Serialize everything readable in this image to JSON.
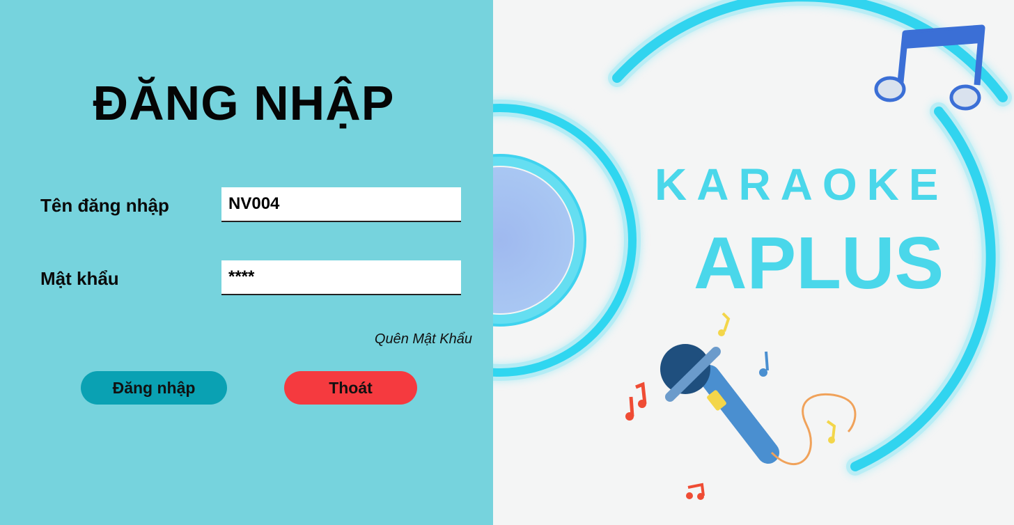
{
  "login": {
    "title": "ĐĂNG NHẬP",
    "username_label": "Tên đăng nhập",
    "username_value": "NV004",
    "password_label": "Mật khẩu",
    "password_value": "****",
    "forgot_password": "Quên Mật Khẩu",
    "login_button": "Đăng nhập",
    "exit_button": "Thoát"
  },
  "branding": {
    "line1": "KARAOKE",
    "line2": "APLUS"
  },
  "colors": {
    "left_background": "#76d3dd",
    "login_button": "#0aa1b3",
    "exit_button": "#f53a3f",
    "neon_blue": "#2fd6f0"
  }
}
